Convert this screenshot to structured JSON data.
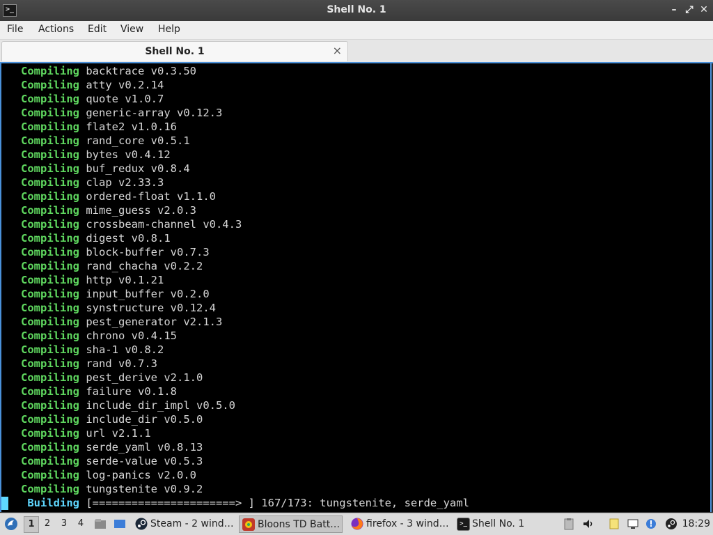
{
  "window": {
    "title": "Shell No. 1",
    "app_icon": "terminal-icon",
    "app_icon_glyph": ">_",
    "controls": {
      "minimize": "–",
      "maximize": "⤢",
      "close": "✕"
    }
  },
  "menu": [
    "File",
    "Actions",
    "Edit",
    "View",
    "Help"
  ],
  "tab": {
    "label": "Shell No. 1",
    "close": "×"
  },
  "terminal": {
    "lines": [
      {
        "kw": "Compiling",
        "text": "backtrace v0.3.50"
      },
      {
        "kw": "Compiling",
        "text": "atty v0.2.14"
      },
      {
        "kw": "Compiling",
        "text": "quote v1.0.7"
      },
      {
        "kw": "Compiling",
        "text": "generic-array v0.12.3"
      },
      {
        "kw": "Compiling",
        "text": "flate2 v1.0.16"
      },
      {
        "kw": "Compiling",
        "text": "rand_core v0.5.1"
      },
      {
        "kw": "Compiling",
        "text": "bytes v0.4.12"
      },
      {
        "kw": "Compiling",
        "text": "buf_redux v0.8.4"
      },
      {
        "kw": "Compiling",
        "text": "clap v2.33.3"
      },
      {
        "kw": "Compiling",
        "text": "ordered-float v1.1.0"
      },
      {
        "kw": "Compiling",
        "text": "mime_guess v2.0.3"
      },
      {
        "kw": "Compiling",
        "text": "crossbeam-channel v0.4.3"
      },
      {
        "kw": "Compiling",
        "text": "digest v0.8.1"
      },
      {
        "kw": "Compiling",
        "text": "block-buffer v0.7.3"
      },
      {
        "kw": "Compiling",
        "text": "rand_chacha v0.2.2"
      },
      {
        "kw": "Compiling",
        "text": "http v0.1.21"
      },
      {
        "kw": "Compiling",
        "text": "input_buffer v0.2.0"
      },
      {
        "kw": "Compiling",
        "text": "synstructure v0.12.4"
      },
      {
        "kw": "Compiling",
        "text": "pest_generator v2.1.3"
      },
      {
        "kw": "Compiling",
        "text": "chrono v0.4.15"
      },
      {
        "kw": "Compiling",
        "text": "sha-1 v0.8.2"
      },
      {
        "kw": "Compiling",
        "text": "rand v0.7.3"
      },
      {
        "kw": "Compiling",
        "text": "pest_derive v2.1.0"
      },
      {
        "kw": "Compiling",
        "text": "failure v0.1.8"
      },
      {
        "kw": "Compiling",
        "text": "include_dir_impl v0.5.0"
      },
      {
        "kw": "Compiling",
        "text": "include_dir v0.5.0"
      },
      {
        "kw": "Compiling",
        "text": "url v2.1.1"
      },
      {
        "kw": "Compiling",
        "text": "serde_yaml v0.8.13"
      },
      {
        "kw": "Compiling",
        "text": "serde-value v0.5.3"
      },
      {
        "kw": "Compiling",
        "text": "log-panics v2.0.0"
      },
      {
        "kw": "Compiling",
        "text": "tungstenite v0.9.2"
      }
    ],
    "status_line": {
      "kw": "Building",
      "text": "[======================> ] 167/173: tungstenite, serde_yaml"
    },
    "colors": {
      "keyword": "#5fd75f",
      "building": "#5fd7ff",
      "text": "#d7d7d7",
      "background": "#000000"
    }
  },
  "taskbar": {
    "start_icon": "start-menu-icon",
    "workspaces": [
      "1",
      "2",
      "3",
      "4"
    ],
    "active_workspace": "1",
    "tasks": [
      {
        "icon": "steam-icon",
        "label": "Steam - 2 wind…",
        "active": false
      },
      {
        "icon": "game-icon",
        "label": "Bloons TD Batt…",
        "active": true
      },
      {
        "icon": "firefox-icon",
        "label": "firefox - 3 wind…",
        "active": false
      },
      {
        "icon": "terminal-icon",
        "label": "Shell No. 1",
        "active": false
      }
    ],
    "tray_icons": [
      "clipboard-icon",
      "volume-icon",
      "notes-icon",
      "network-icon",
      "update-icon",
      "steam-tray-icon"
    ],
    "clock": "18:29"
  }
}
